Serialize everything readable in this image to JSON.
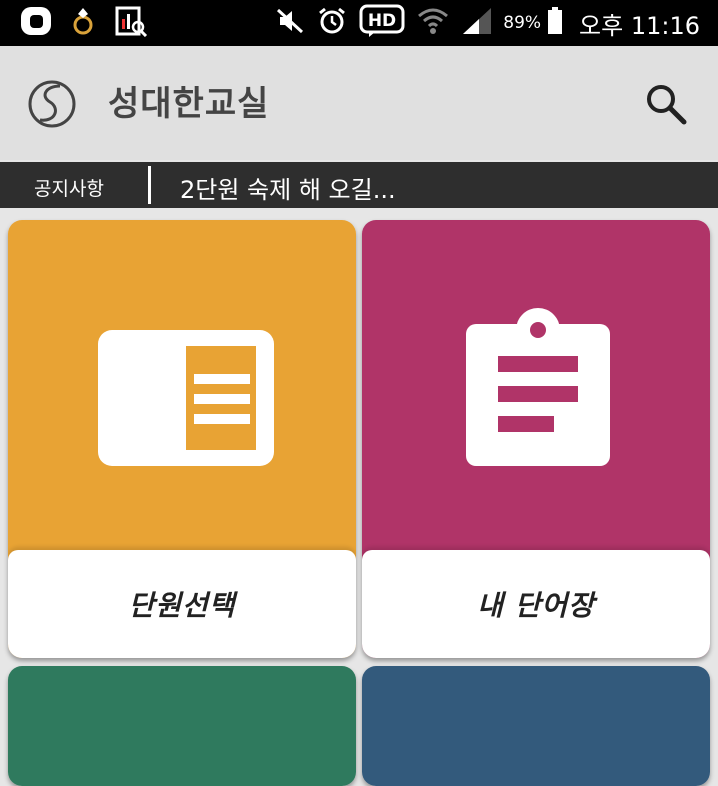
{
  "status_bar": {
    "battery_percent": "89%",
    "time": "오후 11:16"
  },
  "app_bar": {
    "title": "성대한교실"
  },
  "notice": {
    "label": "공지사항",
    "text": "2단원 숙제 해 오길..."
  },
  "tiles": [
    {
      "label": "단원선택",
      "color": "#e8a334",
      "icon": "book-icon"
    },
    {
      "label": "내 단어장",
      "color": "#b03468",
      "icon": "clipboard-icon"
    },
    {
      "label": "",
      "color": "#2f7a5e",
      "icon": ""
    },
    {
      "label": "",
      "color": "#335a7c",
      "icon": ""
    }
  ],
  "colors": {
    "status_bar_bg": "#000000",
    "app_bar_bg": "#e0e0e0",
    "notice_bg": "#2e2e2e",
    "page_bg": "#e6e6e6"
  }
}
